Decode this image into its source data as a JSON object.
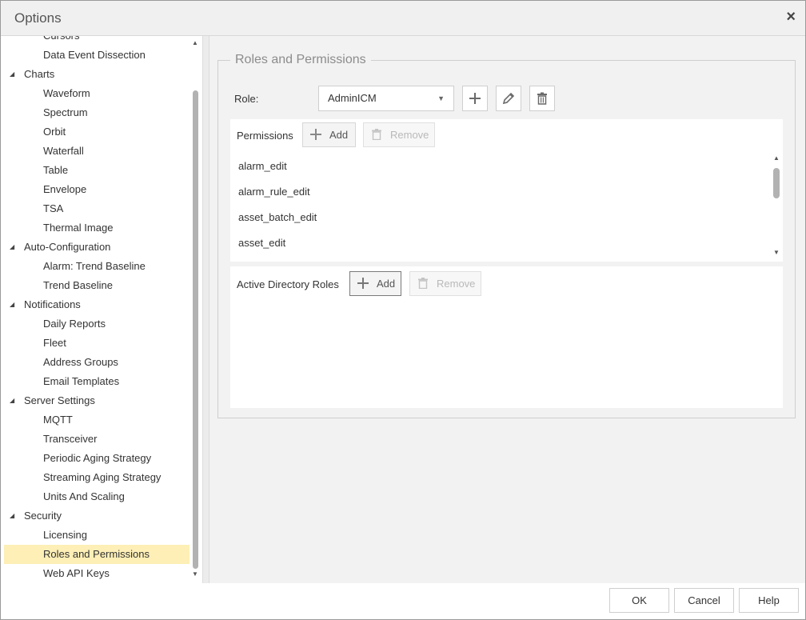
{
  "window": {
    "title": "Options",
    "close_glyph": "×"
  },
  "tree": [
    {
      "label": "Cursors",
      "level": 1
    },
    {
      "label": "Data Event Dissection",
      "level": 1
    },
    {
      "label": "Charts",
      "level": 0
    },
    {
      "label": "Waveform",
      "level": 1
    },
    {
      "label": "Spectrum",
      "level": 1
    },
    {
      "label": "Orbit",
      "level": 1
    },
    {
      "label": "Waterfall",
      "level": 1
    },
    {
      "label": "Table",
      "level": 1
    },
    {
      "label": "Envelope",
      "level": 1
    },
    {
      "label": "TSA",
      "level": 1
    },
    {
      "label": "Thermal Image",
      "level": 1
    },
    {
      "label": "Auto-Configuration",
      "level": 0
    },
    {
      "label": "Alarm: Trend Baseline",
      "level": 1
    },
    {
      "label": "Trend Baseline",
      "level": 1
    },
    {
      "label": "Notifications",
      "level": 0
    },
    {
      "label": "Daily Reports",
      "level": 1
    },
    {
      "label": "Fleet",
      "level": 1
    },
    {
      "label": "Address Groups",
      "level": 1
    },
    {
      "label": "Email Templates",
      "level": 1
    },
    {
      "label": "Server Settings",
      "level": 0
    },
    {
      "label": "MQTT",
      "level": 1
    },
    {
      "label": "Transceiver",
      "level": 1
    },
    {
      "label": "Periodic Aging Strategy",
      "level": 1
    },
    {
      "label": "Streaming Aging Strategy",
      "level": 1
    },
    {
      "label": "Units And Scaling",
      "level": 1
    },
    {
      "label": "Security",
      "level": 0
    },
    {
      "label": "Licensing",
      "level": 1
    },
    {
      "label": "Roles and Permissions",
      "level": 1,
      "selected": true
    },
    {
      "label": "Web API Keys",
      "level": 1
    }
  ],
  "main": {
    "section_title": "Roles and Permissions",
    "role_label": "Role:",
    "role_value": "AdminICM",
    "permissions": {
      "title": "Permissions",
      "add_label": "Add",
      "remove_label": "Remove",
      "items": [
        "alarm_edit",
        "alarm_rule_edit",
        "asset_batch_edit",
        "asset_edit"
      ]
    },
    "ad_roles": {
      "title": "Active Directory Roles",
      "add_label": "Add",
      "remove_label": "Remove"
    }
  },
  "footer": {
    "ok": "OK",
    "cancel": "Cancel",
    "help": "Help"
  },
  "colors": {
    "selected_row": "#fdefb6",
    "panel_bg": "#f2f2f2"
  }
}
